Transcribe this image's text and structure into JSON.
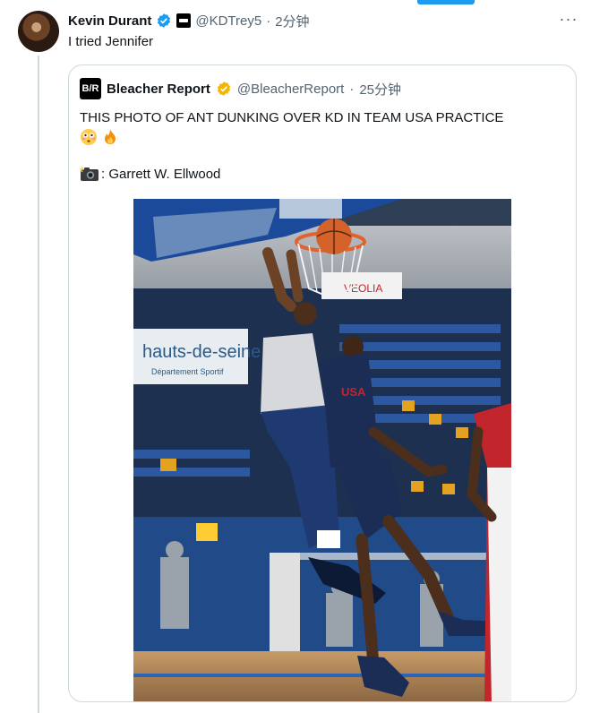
{
  "tweet": {
    "display_name": "Kevin Durant",
    "handle": "@KDTrey5",
    "separator": "·",
    "time": "2分钟",
    "text": "I tried Jennifer",
    "more_label": "···"
  },
  "quote": {
    "display_name": "Bleacher Report",
    "logo_text": "B/R",
    "handle": "@BleacherReport",
    "separator": "·",
    "time": "25分钟",
    "text": "THIS PHOTO OF ANT DUNKING OVER KD IN TEAM USA PRACTICE",
    "credit": ": Garrett W. Ellwood",
    "photo": {
      "banner_text": "hauts-de-seine",
      "banner_subtext": "Département Sportif",
      "sponsor_text": "VEOLIA",
      "jersey_text": "USA"
    }
  },
  "colors": {
    "accent": "#1d9bf0",
    "gold_badge": "#f4b400",
    "border": "#cfd9de",
    "muted": "#536471"
  }
}
